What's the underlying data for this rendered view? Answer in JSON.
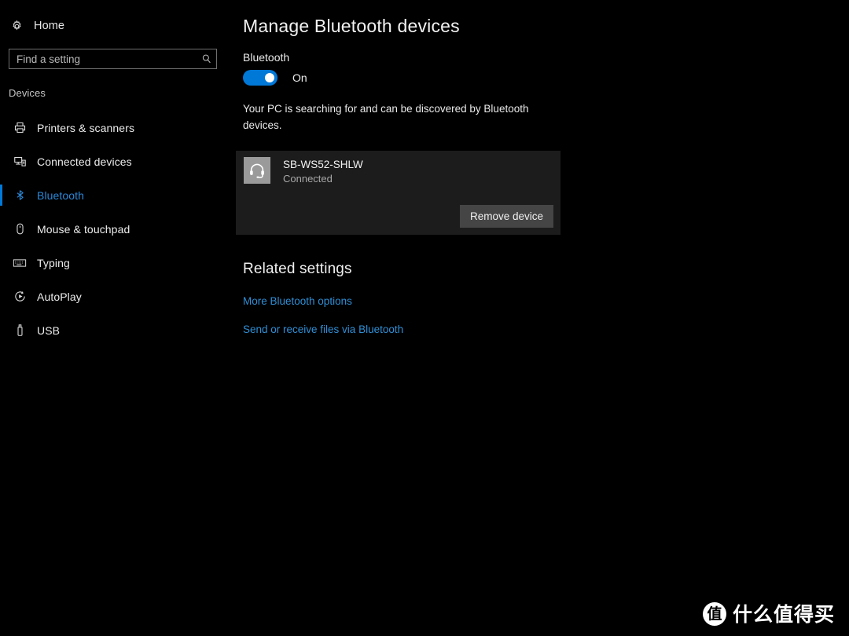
{
  "colors": {
    "page_background": "#000000",
    "accent": "#0078d7",
    "selected_text": "#2b88d8",
    "link": "#2f8fd6",
    "card_background": "#1c1c1c",
    "button_background": "#454545",
    "device_icon_background": "#9a9a9a"
  },
  "sidebar": {
    "home": {
      "label": "Home",
      "icon": "gear-icon"
    },
    "search": {
      "value": "",
      "placeholder": "Find a setting",
      "icon": "search-icon"
    },
    "section_label": "Devices",
    "items": [
      {
        "label": "Printers & scanners",
        "icon": "printer-icon",
        "selected": false
      },
      {
        "label": "Connected devices",
        "icon": "connected-devices-icon",
        "selected": false
      },
      {
        "label": "Bluetooth",
        "icon": "bluetooth-icon",
        "selected": true
      },
      {
        "label": "Mouse & touchpad",
        "icon": "mouse-icon",
        "selected": false
      },
      {
        "label": "Typing",
        "icon": "keyboard-icon",
        "selected": false
      },
      {
        "label": "AutoPlay",
        "icon": "autoplay-icon",
        "selected": false
      },
      {
        "label": "USB",
        "icon": "usb-icon",
        "selected": false
      }
    ]
  },
  "main": {
    "title": "Manage Bluetooth devices",
    "bluetooth_label": "Bluetooth",
    "toggle_state": "On",
    "toggle_on": true,
    "description": "Your PC is searching for and can be discovered by Bluetooth devices.",
    "device": {
      "name": "SB-WS52-SHLW",
      "status": "Connected",
      "icon": "headset-icon",
      "remove_button": "Remove device"
    },
    "related": {
      "title": "Related settings",
      "links": [
        "More Bluetooth options",
        "Send or receive files via Bluetooth"
      ]
    }
  },
  "watermark": {
    "logo_char": "值",
    "text": "什么值得买"
  }
}
